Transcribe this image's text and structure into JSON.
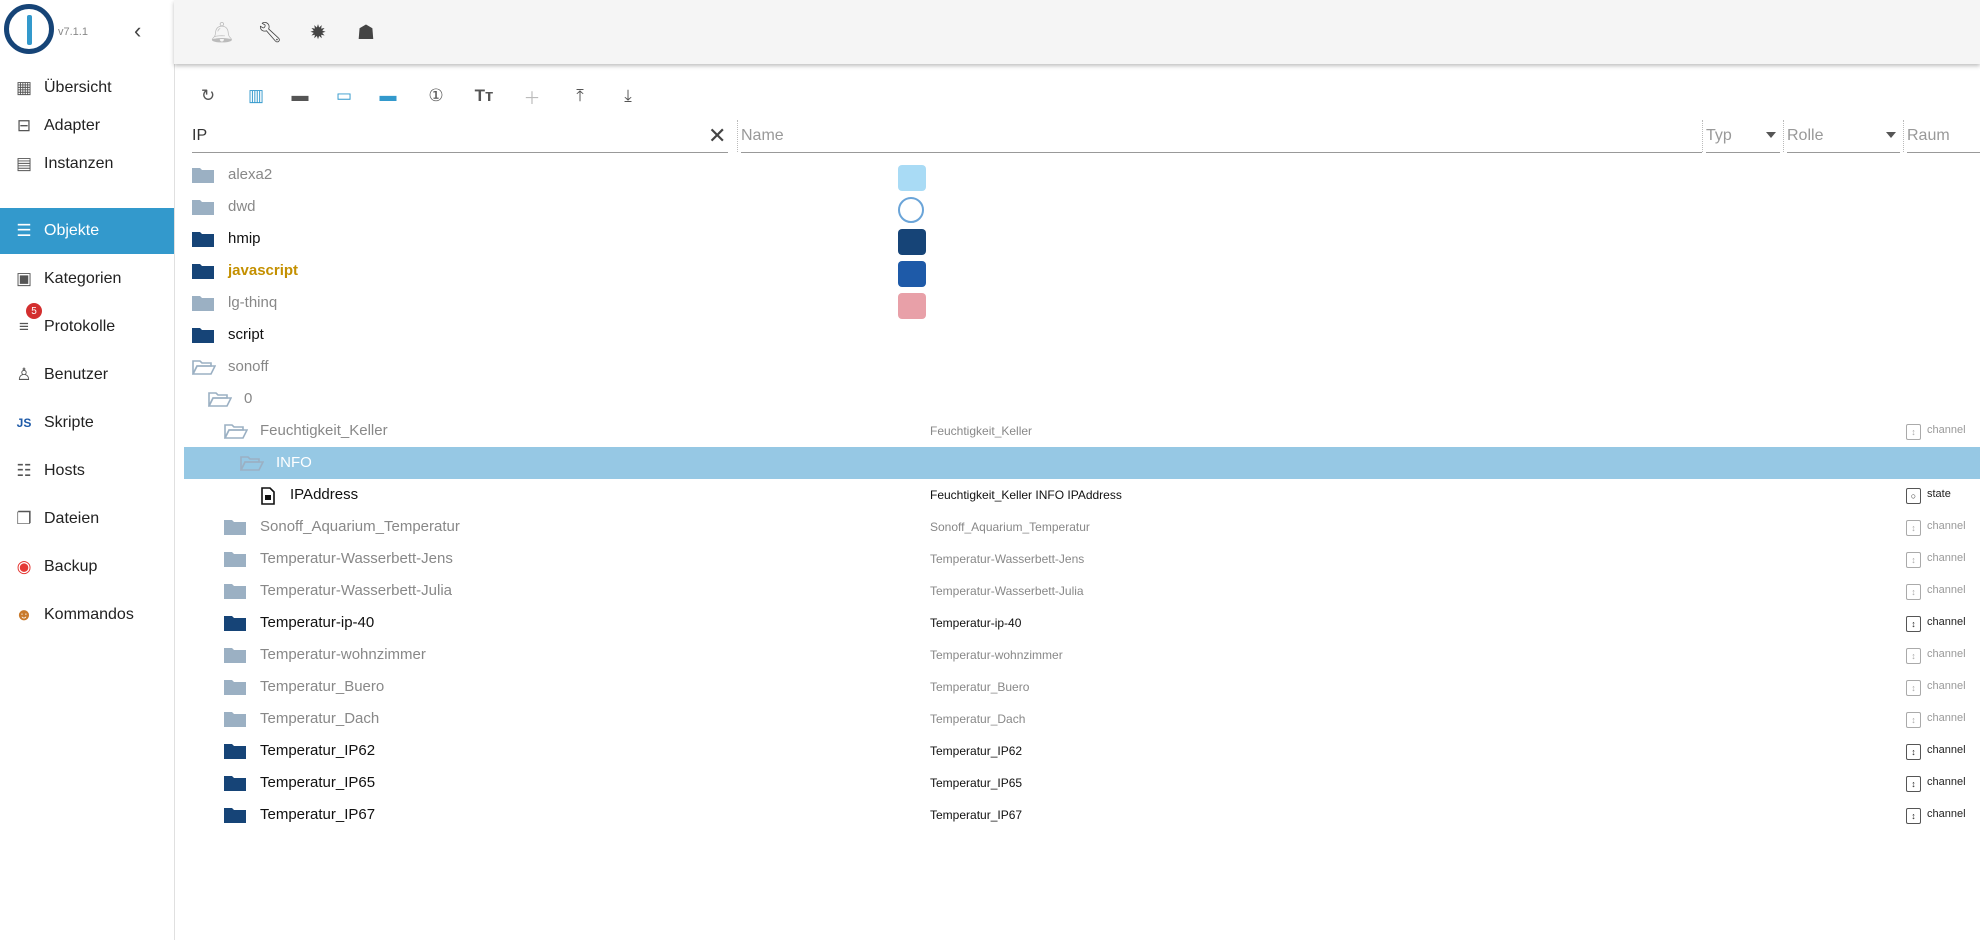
{
  "app": {
    "version": "v7.1.1"
  },
  "sidebar": {
    "items": [
      {
        "label": "Übersicht",
        "icon": "grid-icon"
      },
      {
        "label": "Adapter",
        "icon": "store-icon"
      },
      {
        "label": "Instanzen",
        "icon": "instances-icon"
      },
      {
        "label": "Objekte",
        "icon": "list-icon",
        "active": true
      },
      {
        "label": "Kategorien",
        "icon": "categories-icon"
      },
      {
        "label": "Protokolle",
        "icon": "log-icon",
        "badge": "5"
      },
      {
        "label": "Benutzer",
        "icon": "user-icon"
      },
      {
        "label": "Skripte",
        "icon": "js-icon"
      },
      {
        "label": "Hosts",
        "icon": "hosts-icon"
      },
      {
        "label": "Dateien",
        "icon": "files-icon"
      },
      {
        "label": "Backup",
        "icon": "backup-icon"
      },
      {
        "label": "Kommandos",
        "icon": "commands-icon"
      }
    ]
  },
  "filters": {
    "id": "IP",
    "name_placeholder": "Name",
    "type_placeholder": "Typ",
    "role_placeholder": "Rolle",
    "room_placeholder": "Raum"
  },
  "colors": {
    "accent": "#3399cc",
    "selected_row": "#96c8e4",
    "folder_dark": "#164477",
    "folder_gray": "#9bb0c3"
  },
  "tree": [
    {
      "name": "alexa2",
      "style": "gray",
      "folder": "gray",
      "icon": "alexa"
    },
    {
      "name": "dwd",
      "style": "gray",
      "folder": "gray",
      "icon": "dwd"
    },
    {
      "name": "hmip",
      "style": "dark",
      "folder": "dark",
      "icon": "hmip"
    },
    {
      "name": "javascript",
      "style": "yellow",
      "folder": "dark",
      "icon": "js"
    },
    {
      "name": "lg-thinq",
      "style": "gray",
      "folder": "gray",
      "icon": "lg"
    },
    {
      "name": "script",
      "style": "dark",
      "folder": "dark"
    },
    {
      "name": "sonoff",
      "style": "gray",
      "folder": "open",
      "icon": "sonoff"
    },
    {
      "name": "0",
      "style": "gray",
      "folder": "open",
      "level": 1,
      "icon": "sonoff"
    },
    {
      "name": "Feuchtigkeit_Keller",
      "style": "gray",
      "folder": "open",
      "level": 2,
      "common": "Feuchtigkeit_Keller",
      "type": "channel"
    },
    {
      "name": "INFO",
      "style": "white",
      "folder": "open",
      "level": 3,
      "selected": true
    },
    {
      "name": "IPAddress",
      "style": "dark",
      "folder": "file",
      "level": 4,
      "common": "Feuchtigkeit_Keller INFO IPAddress",
      "type": "state",
      "role": "state"
    },
    {
      "name": "Sonoff_Aquarium_Temperatur",
      "style": "gray",
      "folder": "gray",
      "level": 2,
      "common": "Sonoff_Aquarium_Temperatur",
      "type": "channel"
    },
    {
      "name": "Temperatur-Wasserbett-Jens",
      "style": "gray",
      "folder": "gray",
      "level": 2,
      "common": "Temperatur-Wasserbett-Jens",
      "type": "channel"
    },
    {
      "name": "Temperatur-Wasserbett-Julia",
      "style": "gray",
      "folder": "gray",
      "level": 2,
      "common": "Temperatur-Wasserbett-Julia",
      "type": "channel"
    },
    {
      "name": "Temperatur-ip-40",
      "style": "dark",
      "folder": "dark",
      "level": 2,
      "common": "Temperatur-ip-40",
      "type": "channel"
    },
    {
      "name": "Temperatur-wohnzimmer",
      "style": "gray",
      "folder": "gray",
      "level": 2,
      "common": "Temperatur-wohnzimmer",
      "type": "channel"
    },
    {
      "name": "Temperatur_Buero",
      "style": "gray",
      "folder": "gray",
      "level": 2,
      "common": "Temperatur_Buero",
      "type": "channel"
    },
    {
      "name": "Temperatur_Dach",
      "style": "gray",
      "folder": "gray",
      "level": 2,
      "common": "Temperatur_Dach",
      "type": "channel"
    },
    {
      "name": "Temperatur_IP62",
      "style": "dark",
      "folder": "dark",
      "level": 2,
      "common": "Temperatur_IP62",
      "type": "channel"
    },
    {
      "name": "Temperatur_IP65",
      "style": "dark",
      "folder": "dark",
      "level": 2,
      "common": "Temperatur_IP65",
      "type": "channel"
    },
    {
      "name": "Temperatur_IP67",
      "style": "dark",
      "folder": "dark",
      "level": 2,
      "common": "Temperatur_IP67",
      "type": "channel"
    }
  ]
}
